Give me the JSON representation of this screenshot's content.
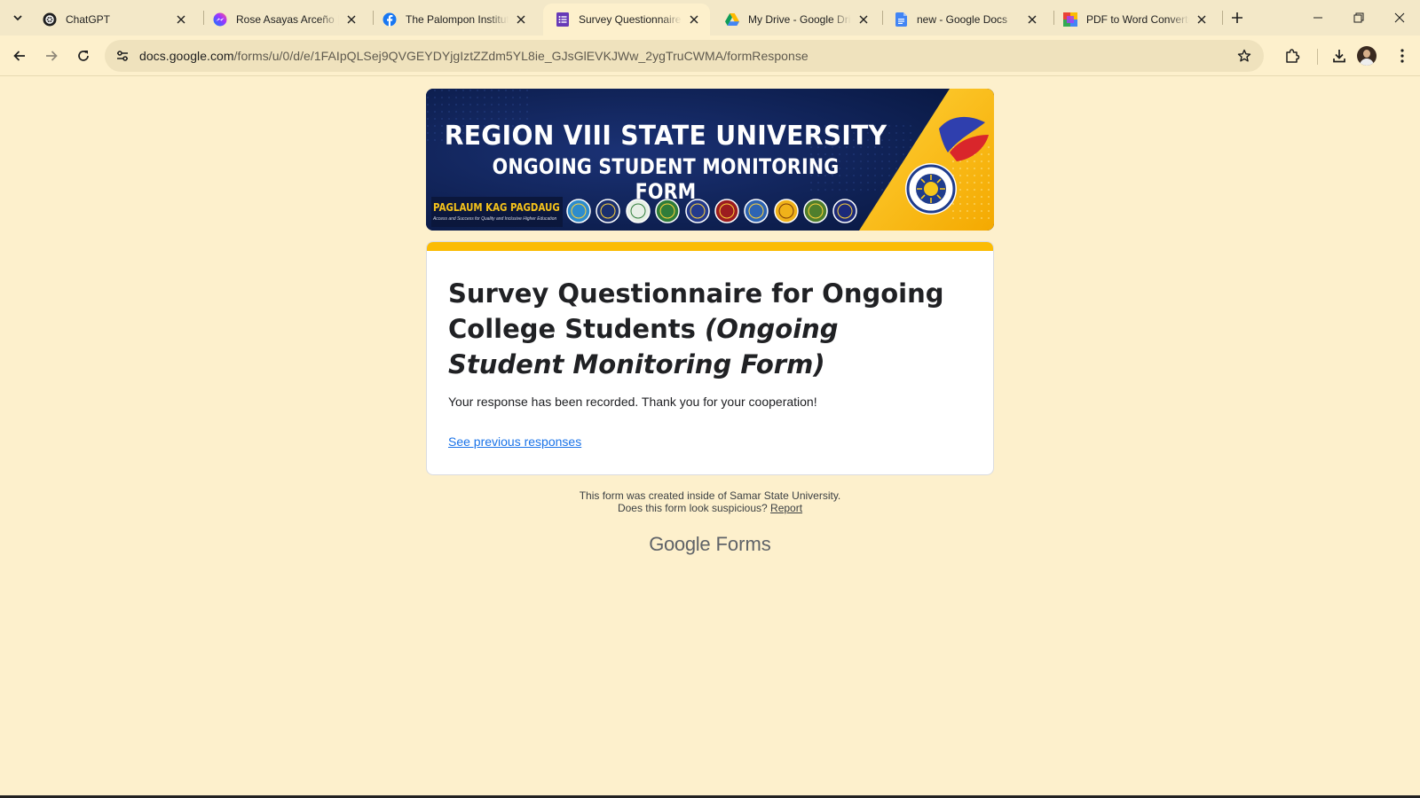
{
  "tabs": [
    {
      "title": "ChatGPT",
      "icon": "chatgpt-icon"
    },
    {
      "title": "Rose Asayas Arceño | M",
      "icon": "messenger-icon"
    },
    {
      "title": "The Palompon Institute",
      "icon": "facebook-icon"
    },
    {
      "title": "Survey Questionnaire f",
      "icon": "google-forms-icon",
      "active": true
    },
    {
      "title": "My Drive - Google Drive",
      "icon": "google-drive-icon"
    },
    {
      "title": "new - Google Docs",
      "icon": "google-docs-icon"
    },
    {
      "title": "PDF to Word Converter",
      "icon": "pdf-converter-icon"
    }
  ],
  "address_bar": {
    "host": "docs.google.com",
    "path": "/forms/u/0/d/e/1FAIpQLSej9QVGEYDYjgIztZZdm5YL8ie_GJsGlEVKJWw_2ygTruCWMA/formResponse"
  },
  "banner": {
    "line1": "REGION VIII STATE UNIVERSITY",
    "line2": "ONGOING STUDENT MONITORING FORM",
    "motto": "PAGLAUM KAG PAGDAUG",
    "motto_sub": "Access and Success for Quality and Inclusive Higher Education"
  },
  "form": {
    "title_main": "Survey Questionnaire for Ongoing College Students ",
    "title_italic": "(Ongoing Student Monitoring Form)",
    "message": "Your response has been recorded. Thank you for your cooperation!",
    "link": "See previous responses"
  },
  "footer": {
    "created": "This form was created inside of Samar State University.",
    "suspicious": "Does this form look suspicious?",
    "report": "Report",
    "brand_google": "Google",
    "brand_forms": "Forms"
  },
  "colors": {
    "page_bg": "#fdf0cc",
    "accent": "#fbbc04",
    "link": "#1a73e8",
    "banner_navy": "#0c1d4b"
  }
}
